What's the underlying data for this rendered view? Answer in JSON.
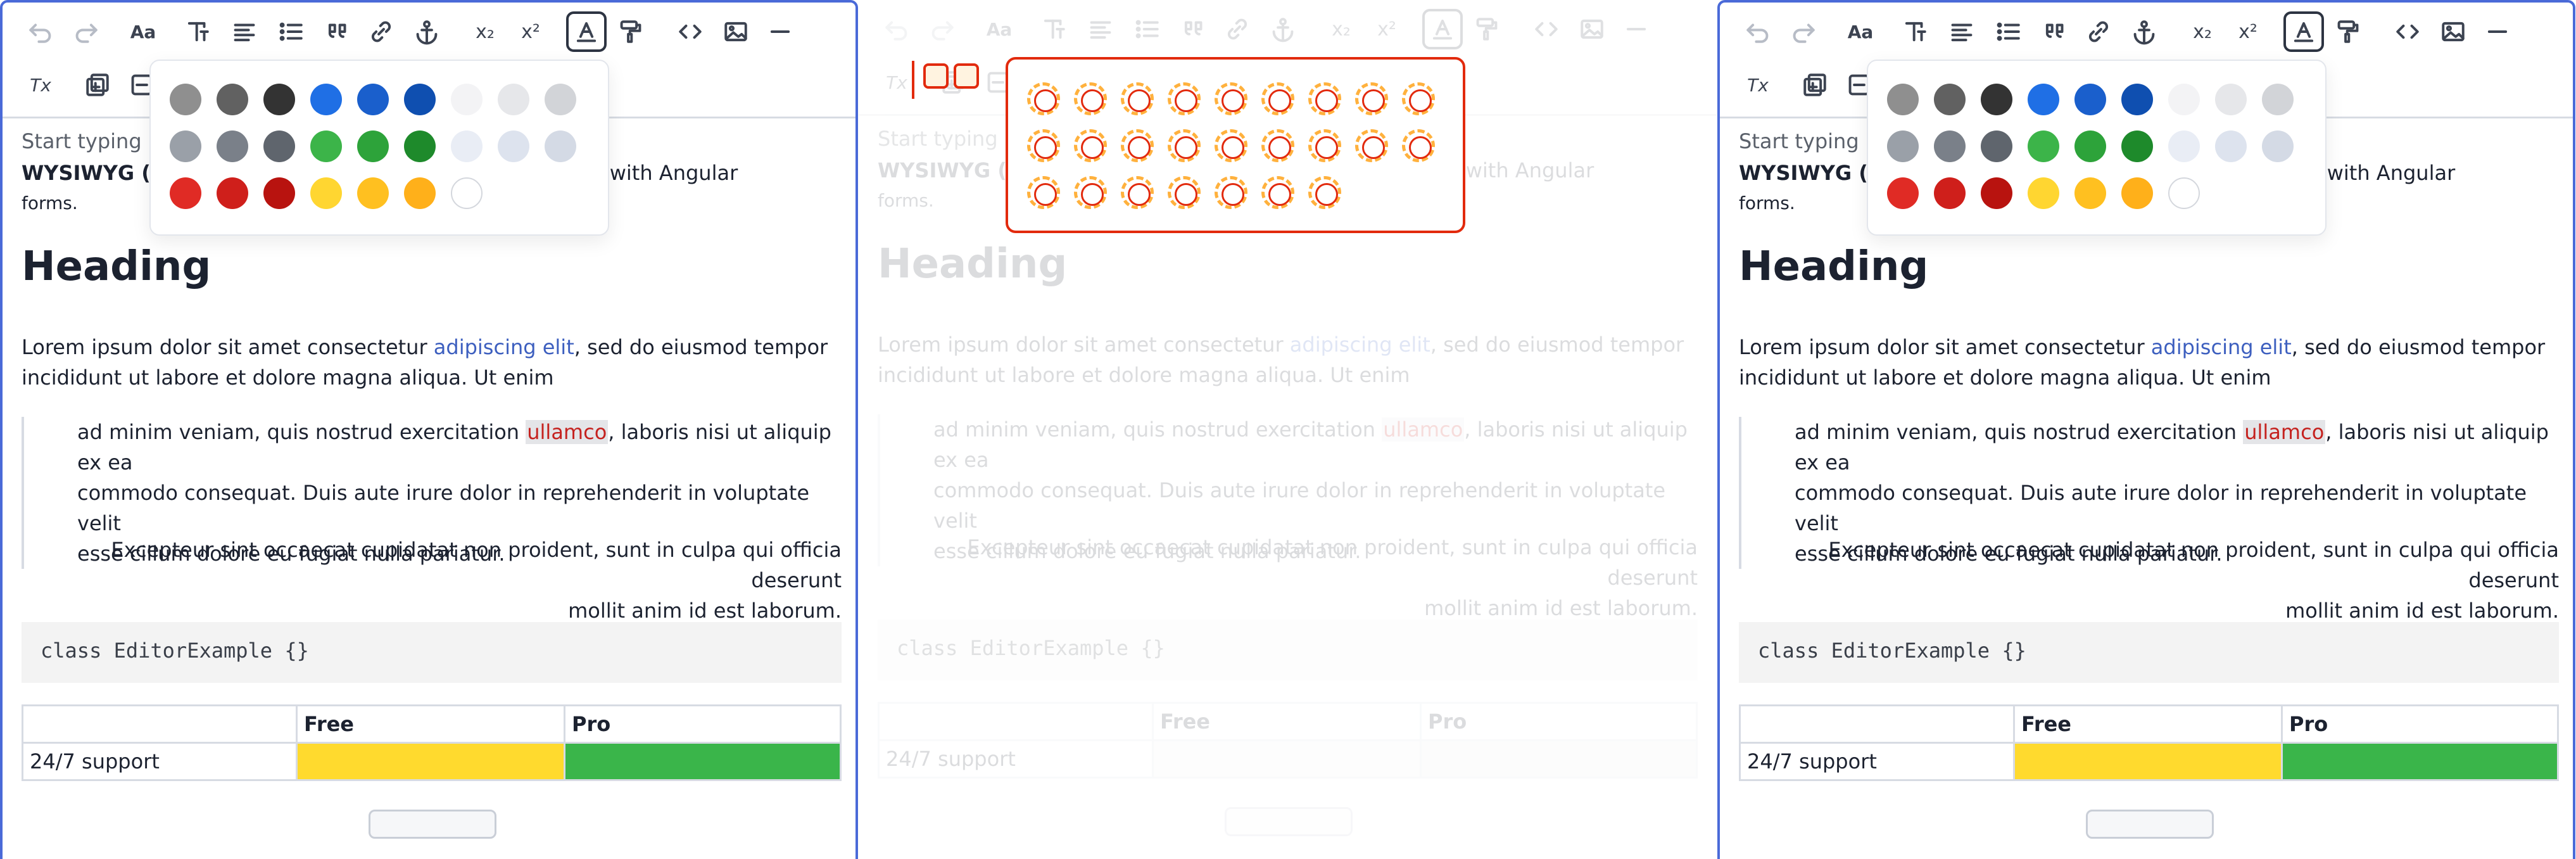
{
  "editor": {
    "placeholder": "Start typing",
    "intro_bold": "WYSIWYG (W",
    "intro_rest": "or using with Angular",
    "intro_tail": "forms.",
    "heading": "Heading",
    "para1_a": "Lorem ipsum dolor sit amet consectetur ",
    "para1_link": "adipiscing elit",
    "para1_b": ", sed do eiusmod tempor",
    "para1_c": "incididunt ut labore et dolore magna aliqua. Ut enim",
    "quote_a": "ad minim veniam, quis nostrud exercitation ",
    "quote_mark": "ullamco",
    "quote_b": ", laboris nisi ut aliquip ex ea",
    "quote_c": "commodo consequat. Duis aute irure dolor in reprehenderit in voluptate velit",
    "quote_d": "esse cillum dolore eu fugiat nulla pariatur.",
    "right_a": "Excepteur sint occaecat cupidatat non proident, sunt in culpa qui officia deserunt",
    "right_b": "mollit anim id est laborum.",
    "code": "class EditorExample {}",
    "table": {
      "headers": [
        "",
        "Free",
        "Pro"
      ],
      "rows": [
        [
          "24/7 support",
          "",
          ""
        ]
      ]
    }
  },
  "toolbar": {
    "buttons": [
      {
        "name": "undo",
        "icon": "undo-icon"
      },
      {
        "name": "redo",
        "icon": "redo-icon"
      },
      {
        "name": "font-size",
        "icon": "text-size-icon",
        "glyph": "Aa"
      },
      {
        "name": "text-style",
        "icon": "text-style-icon"
      },
      {
        "name": "align",
        "icon": "align-icon"
      },
      {
        "name": "bullet-list",
        "icon": "list-icon"
      },
      {
        "name": "blockquote",
        "icon": "quote-icon"
      },
      {
        "name": "link",
        "icon": "link-icon"
      },
      {
        "name": "anchor",
        "icon": "anchor-icon"
      },
      {
        "name": "subscript",
        "icon": "subscript-icon",
        "glyph": "x₂"
      },
      {
        "name": "superscript",
        "icon": "superscript-icon",
        "glyph": "x²"
      },
      {
        "name": "text-color",
        "icon": "text-color-icon"
      },
      {
        "name": "highlight",
        "icon": "paint-roller-icon"
      },
      {
        "name": "code",
        "icon": "code-icon"
      },
      {
        "name": "image",
        "icon": "image-icon"
      },
      {
        "name": "horizontal-rule",
        "icon": "horizontal-rule-icon"
      },
      {
        "name": "clear-format",
        "icon": "clear-format-icon",
        "glyph": "Tx"
      },
      {
        "name": "insert-table",
        "icon": "insert-table-icon"
      },
      {
        "name": "delete-table",
        "icon": "delete-table-icon"
      }
    ]
  },
  "palette": {
    "colors": [
      "#8f8f8f",
      "#616161",
      "#333333",
      "#1f6fe5",
      "#1a5fcc",
      "#0f4fb0",
      "#f3f3f5",
      "#e6e7ea",
      "#d2d4d8",
      "#9aa0a8",
      "#7a8089",
      "#5f656d",
      "#3cb449",
      "#2da33a",
      "#1e8a2b",
      "#e9edf5",
      "#dde3ee",
      "#d4dae5",
      "#e02b25",
      "#cf1f1b",
      "#b8130f",
      "#ffd631",
      "#ffc020",
      "#ffb01a",
      "#ffffff"
    ]
  },
  "table_colors": {
    "free": "#ffda2e",
    "pro": "#3ab54a"
  },
  "accent": "#4a6ad8"
}
